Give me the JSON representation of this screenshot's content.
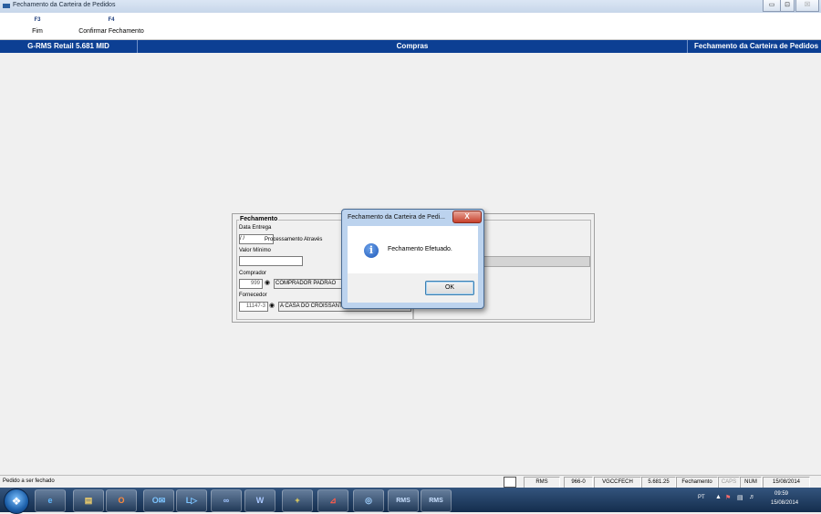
{
  "window": {
    "title": "Fechamento da Carteira de Pedidos",
    "controls": [
      "▭",
      "⊡",
      "☒"
    ]
  },
  "fkeys": [
    {
      "key": "F3",
      "label": "Fim"
    },
    {
      "key": "F4",
      "label": "Confirmar Fechamento"
    }
  ],
  "header": {
    "app": "G-RMS Retail 5.681 MID",
    "module": "Compras",
    "screen": "Fechamento da Carteira de Pedidos"
  },
  "form": {
    "group_title": "Fechamento",
    "data_entrega_label": "Data Entrega",
    "data_entrega_value": " / /",
    "processamento_label": "Processamento Através",
    "valor_minimo_label": "Valor Mínimo",
    "valor_minimo_value": "",
    "comprador_label": "Comprador",
    "comprador_code": "999",
    "comprador_name": "COMPRADOR PADRAO",
    "fornecedor_label": "Fornecedor",
    "fornecedor_code": "11147-3",
    "fornecedor_name": "A CASA DO CROISSANT LTDA"
  },
  "dialog": {
    "title": "Fechamento da Carteira de Pedi...",
    "close": "X",
    "icon": "info-icon",
    "message": "Fechamento Efetuado.",
    "ok": "OK"
  },
  "statusbar": {
    "message": "Pedido a ser fechado",
    "cells": [
      "RMS",
      "966-0",
      "VGCCFECH",
      "5.681.25",
      "Fechamento",
      "CAPS",
      "NUM",
      "15/08/2014"
    ]
  },
  "taskbar": {
    "apps": [
      "e",
      "▤",
      "O",
      "O✉",
      "L▷",
      "∞",
      "W",
      "+",
      "⊿",
      "◎",
      "RMS",
      "RMS"
    ],
    "tray_lang": "PT",
    "clock_time": "09:59",
    "clock_date": "15/08/2014"
  },
  "colors": {
    "header_blue": "#0c3f93",
    "taskbar": "#1e3c66"
  }
}
